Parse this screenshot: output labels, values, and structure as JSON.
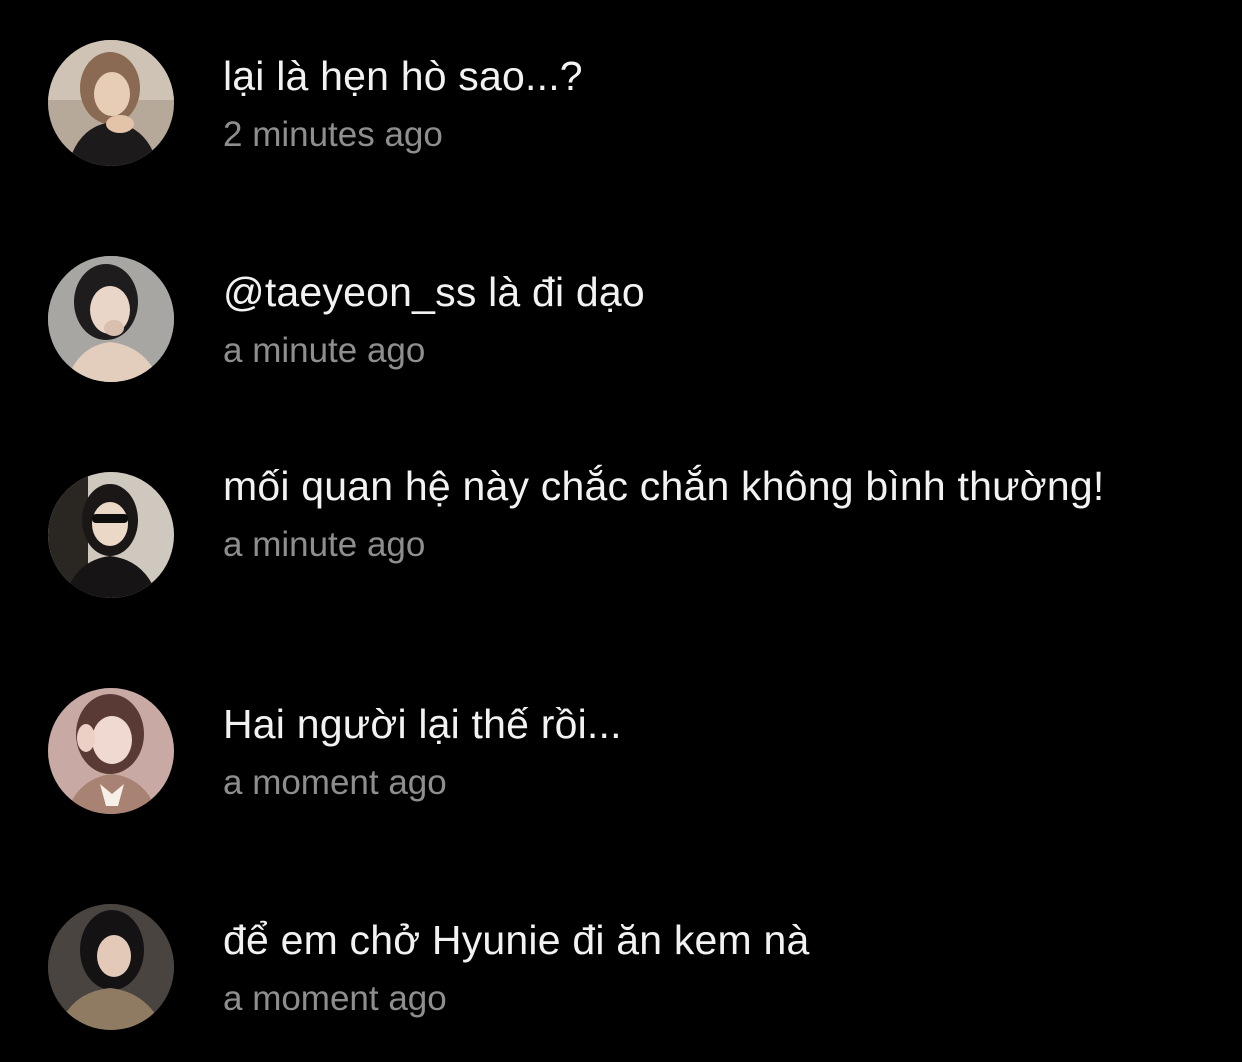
{
  "comments": [
    {
      "avatar_icon": "user-avatar-photo-icon",
      "text": "lại là hẹn hò sao...?",
      "time": "2 minutes ago"
    },
    {
      "avatar_icon": "user-avatar-photo-icon",
      "text": "@taeyeon_ss là đi dạo",
      "time": "a minute ago"
    },
    {
      "avatar_icon": "user-avatar-photo-icon",
      "text": "mối quan hệ này chắc chắn không bình thường!",
      "time": "a minute ago"
    },
    {
      "avatar_icon": "user-avatar-photo-icon",
      "text": "Hai người lại thế rồi...",
      "time": "a moment ago"
    },
    {
      "avatar_icon": "user-avatar-photo-icon",
      "text": "để em chở Hyunie đi ăn kem nà",
      "time": "a moment ago"
    }
  ],
  "colors": {
    "background": "#000000",
    "text": "#f2f2f2",
    "timestamp": "#8e8e8e"
  }
}
